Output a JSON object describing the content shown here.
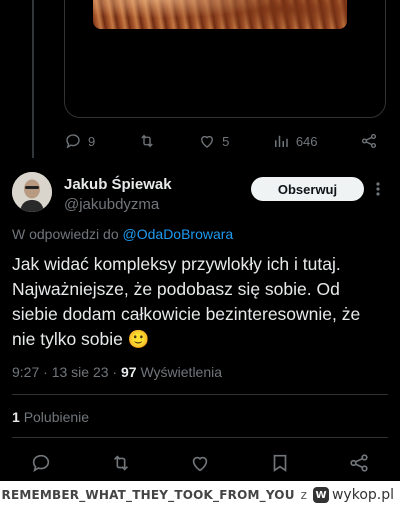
{
  "quoted_tweet": {
    "reply_count": "9",
    "like_count": "5",
    "views_count": "646"
  },
  "tweet": {
    "author_name": "Jakub Śpiewak",
    "author_handle": "@jakubdyzma",
    "follow_label": "Obserwuj",
    "reply_prefix": "W odpowiedzi do",
    "reply_to": "@OdaDoBrowara",
    "text": "Jak widać kompleksy przywlokły ich i tutaj. Najważniejsze, że podobasz się sobie. Od siebie dodam całkowicie bezinteresownie, że nie tylko sobie 🙂",
    "time": "9:27",
    "date": "13 sie 23",
    "views": "97",
    "views_label": "Wyświetlenia",
    "likes_count": "1",
    "likes_label": "Polubienie"
  },
  "footer": {
    "username": "REMEMBER_WHAT_THEY_TOOK_FROM_YOU",
    "separator": "z",
    "site": "wykop.pl"
  },
  "colors": {
    "accent": "#1d9bf0",
    "muted": "#71767b",
    "text": "#e7e9ea"
  }
}
